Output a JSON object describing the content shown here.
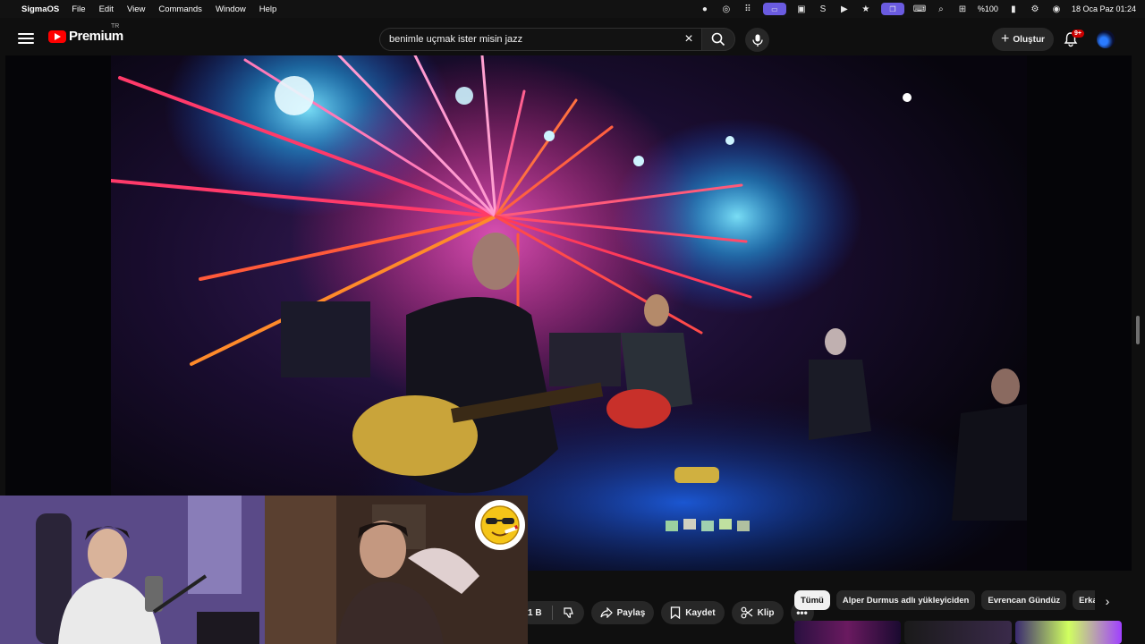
{
  "menubar": {
    "app_name": "SigmaOS",
    "menus": [
      "File",
      "Edit",
      "View",
      "Commands",
      "Window",
      "Help"
    ],
    "battery": "%100",
    "datetime": "18 Oca Paz  01:24"
  },
  "header": {
    "logo_text": "Premium",
    "country_code": "TR",
    "search_query": "benimle uçmak ister misin jazz",
    "create_label": "Oluştur",
    "notification_badge": "9+"
  },
  "video": {
    "description": "Jazz band live stage performance with red and blue lights"
  },
  "actions": {
    "like_count_fragment": "1 B",
    "share_label": "Paylaş",
    "save_label": "Kaydet",
    "clip_label": "Klip",
    "more_label": "•••"
  },
  "chips": [
    "Tümü",
    "Alper Durmus adlı yükleyiciden",
    "Evrencan Gündüz",
    "Erkan Oğur"
  ],
  "colors": {
    "youtube_red": "#ff0000",
    "chip_active_bg": "#f1f1f1",
    "menubar_accent": "#6a5be0"
  }
}
